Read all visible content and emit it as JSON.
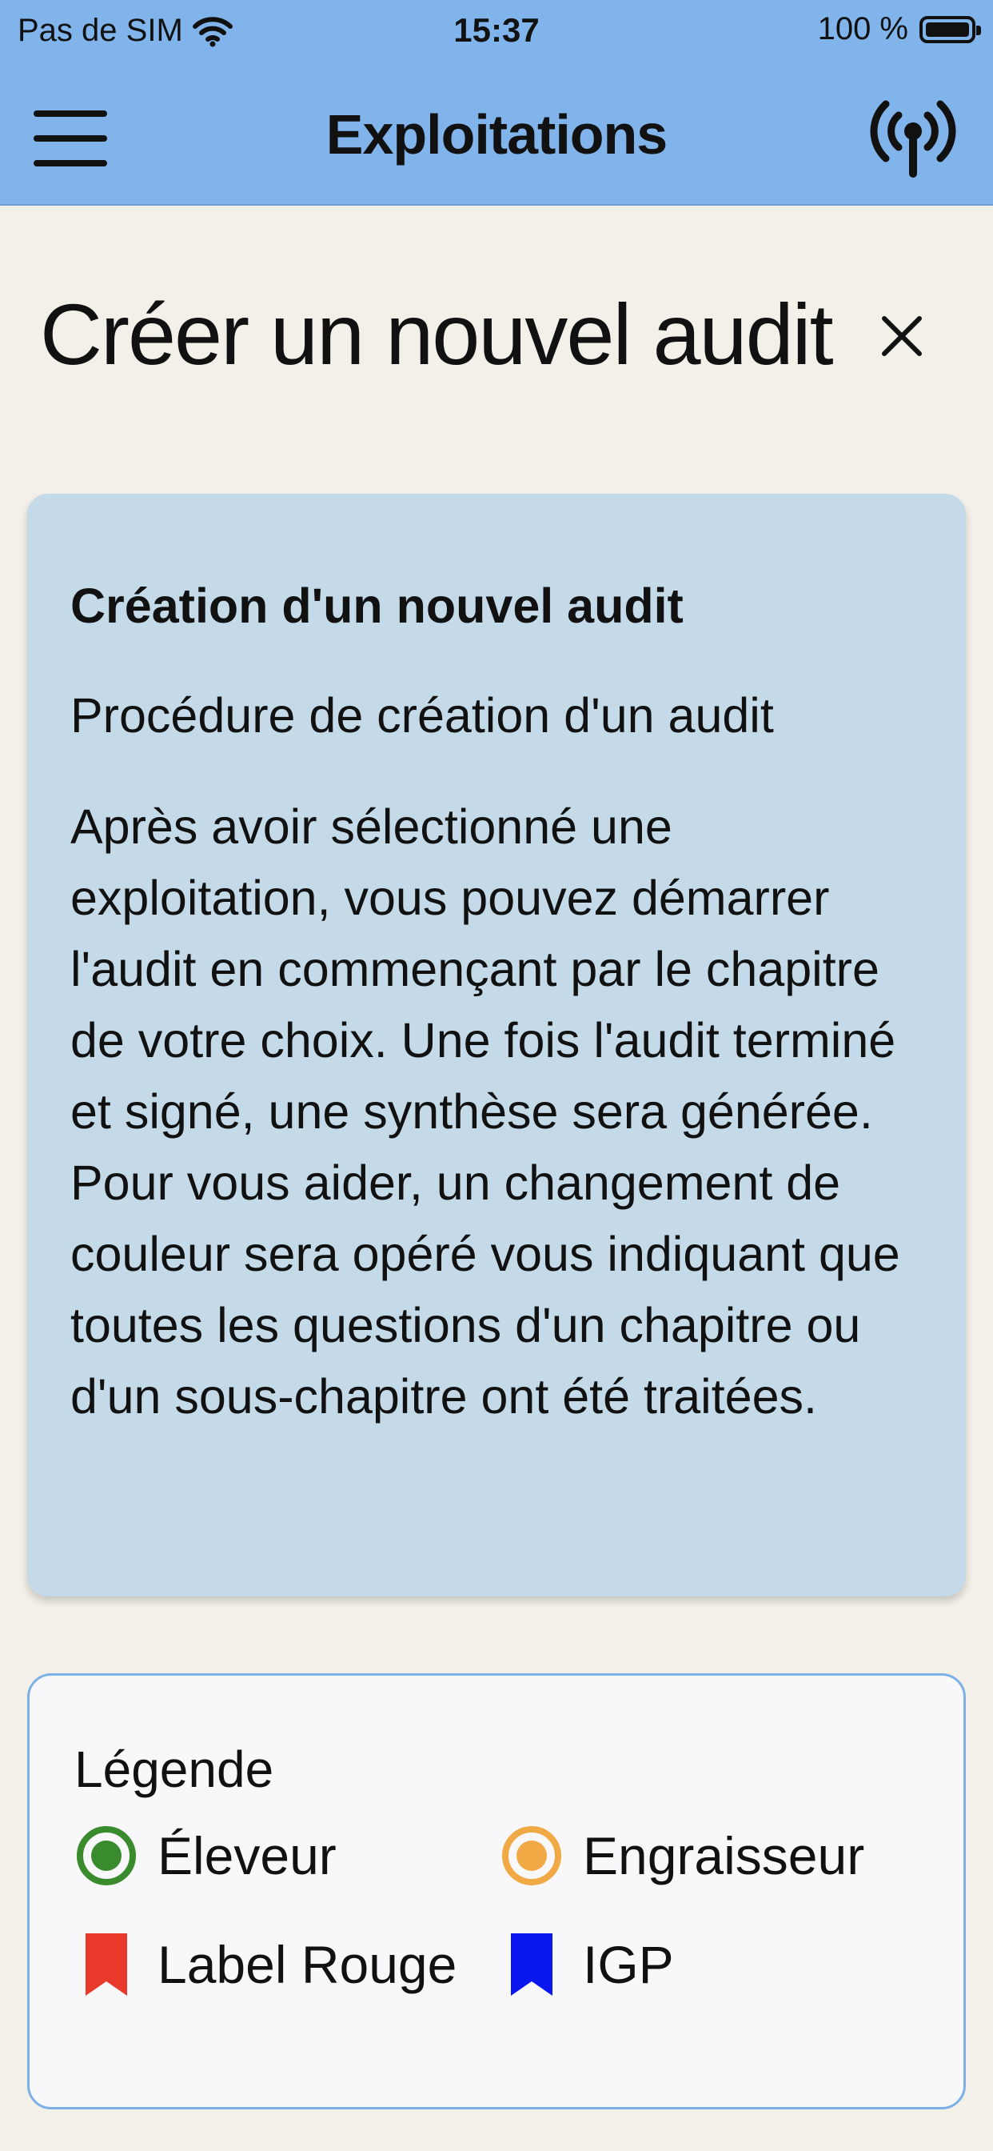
{
  "status_bar": {
    "carrier": "Pas de SIM",
    "time": "15:37",
    "battery_percent": "100 %",
    "battery_level": 1.0
  },
  "nav": {
    "title": "Exploitations",
    "menu_icon": "hamburger-menu-icon",
    "sync_icon": "antenna-signal-icon"
  },
  "page": {
    "title": "Créer un nouvel audit",
    "close_icon": "close-icon"
  },
  "info_card": {
    "title": "Création d'un nouvel audit",
    "subtitle": "Procédure de création d'un audit",
    "body": "Après avoir sélectionné une exploitation, vous pouvez démarrer l'audit en commençant par le chapitre de votre choix. Une fois l'audit terminé et signé, une synthèse sera générée. Pour vous aider, un changement de couleur sera opéré vous indiquant que toutes les questions d'un chapitre ou d'un sous-chapitre ont été traitées."
  },
  "legend": {
    "title": "Légende",
    "items": [
      {
        "label": "Éleveur",
        "icon": "radio-circle-icon",
        "color": "#3a8a2e"
      },
      {
        "label": "Engraisseur",
        "icon": "radio-circle-icon",
        "color": "#f0a944"
      },
      {
        "label": "Label Rouge",
        "icon": "bookmark-icon",
        "color": "#e8392a"
      },
      {
        "label": "IGP",
        "icon": "bookmark-icon",
        "color": "#0a17f0"
      }
    ]
  },
  "colors": {
    "header_background": "#80b4eb",
    "page_background": "#f3f0e9",
    "info_card_background": "#c4dae9",
    "legend_border": "#7db0e6"
  }
}
